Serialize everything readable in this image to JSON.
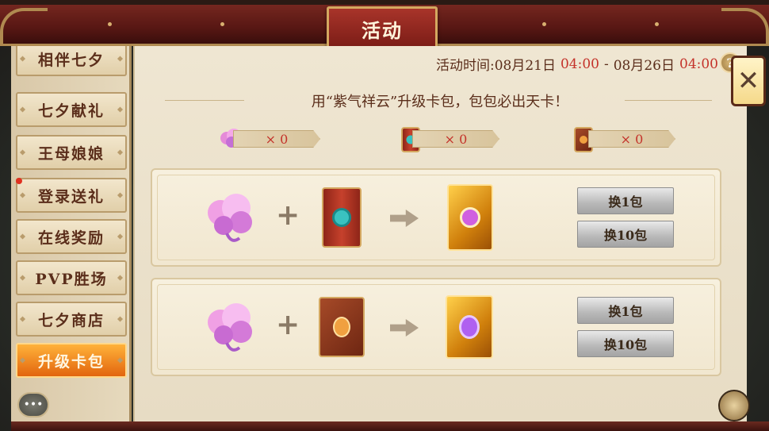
{
  "window": {
    "title": "活动"
  },
  "sidebar": {
    "tabs": [
      {
        "label": "相伴七夕",
        "active": false,
        "badge": false
      },
      {
        "label": "七夕献礼",
        "active": false,
        "badge": false
      },
      {
        "label": "王母娘娘",
        "active": false,
        "badge": false
      },
      {
        "label": "登录送礼",
        "active": false,
        "badge": true
      },
      {
        "label": "在线奖励",
        "active": false,
        "badge": false
      },
      {
        "label": "PVP胜场",
        "active": false,
        "badge": false
      },
      {
        "label": "七夕商店",
        "active": false,
        "badge": false
      },
      {
        "label": "升级卡包",
        "active": true,
        "badge": false
      }
    ],
    "chat_icon": "chat-bubble-icon"
  },
  "event": {
    "time_label": "活动时间:08月21日",
    "start_time": "04:00",
    "separator": "-",
    "end_date": "08月26日",
    "end_time": "04:00",
    "help_label": "?",
    "subtitle": "用“紫气祥云”升级卡包，包包必出天卡！"
  },
  "inventory": [
    {
      "icon": "purple-cloud-icon",
      "count": "× 0"
    },
    {
      "icon": "red-card-pack-icon",
      "count": "× 0"
    },
    {
      "icon": "brown-card-pack-icon",
      "count": "× 0"
    }
  ],
  "recipes": [
    {
      "ingredient_a": "purple-cloud-icon",
      "plus": "+",
      "ingredient_b": "red-card-pack-icon",
      "result": "golden-upgraded-pack-icon",
      "buttons": {
        "one": "换1包",
        "ten": "换10包"
      }
    },
    {
      "ingredient_a": "purple-cloud-icon",
      "plus": "+",
      "ingredient_b": "brown-card-pack-icon",
      "result": "golden-card-pack-icon",
      "buttons": {
        "one": "换1包",
        "ten": "换10包"
      }
    }
  ],
  "close_label": "✕",
  "colors": {
    "accent_red": "#c4322a",
    "active_tab": "#f08a1a",
    "text_brown": "#5b2e1b"
  }
}
